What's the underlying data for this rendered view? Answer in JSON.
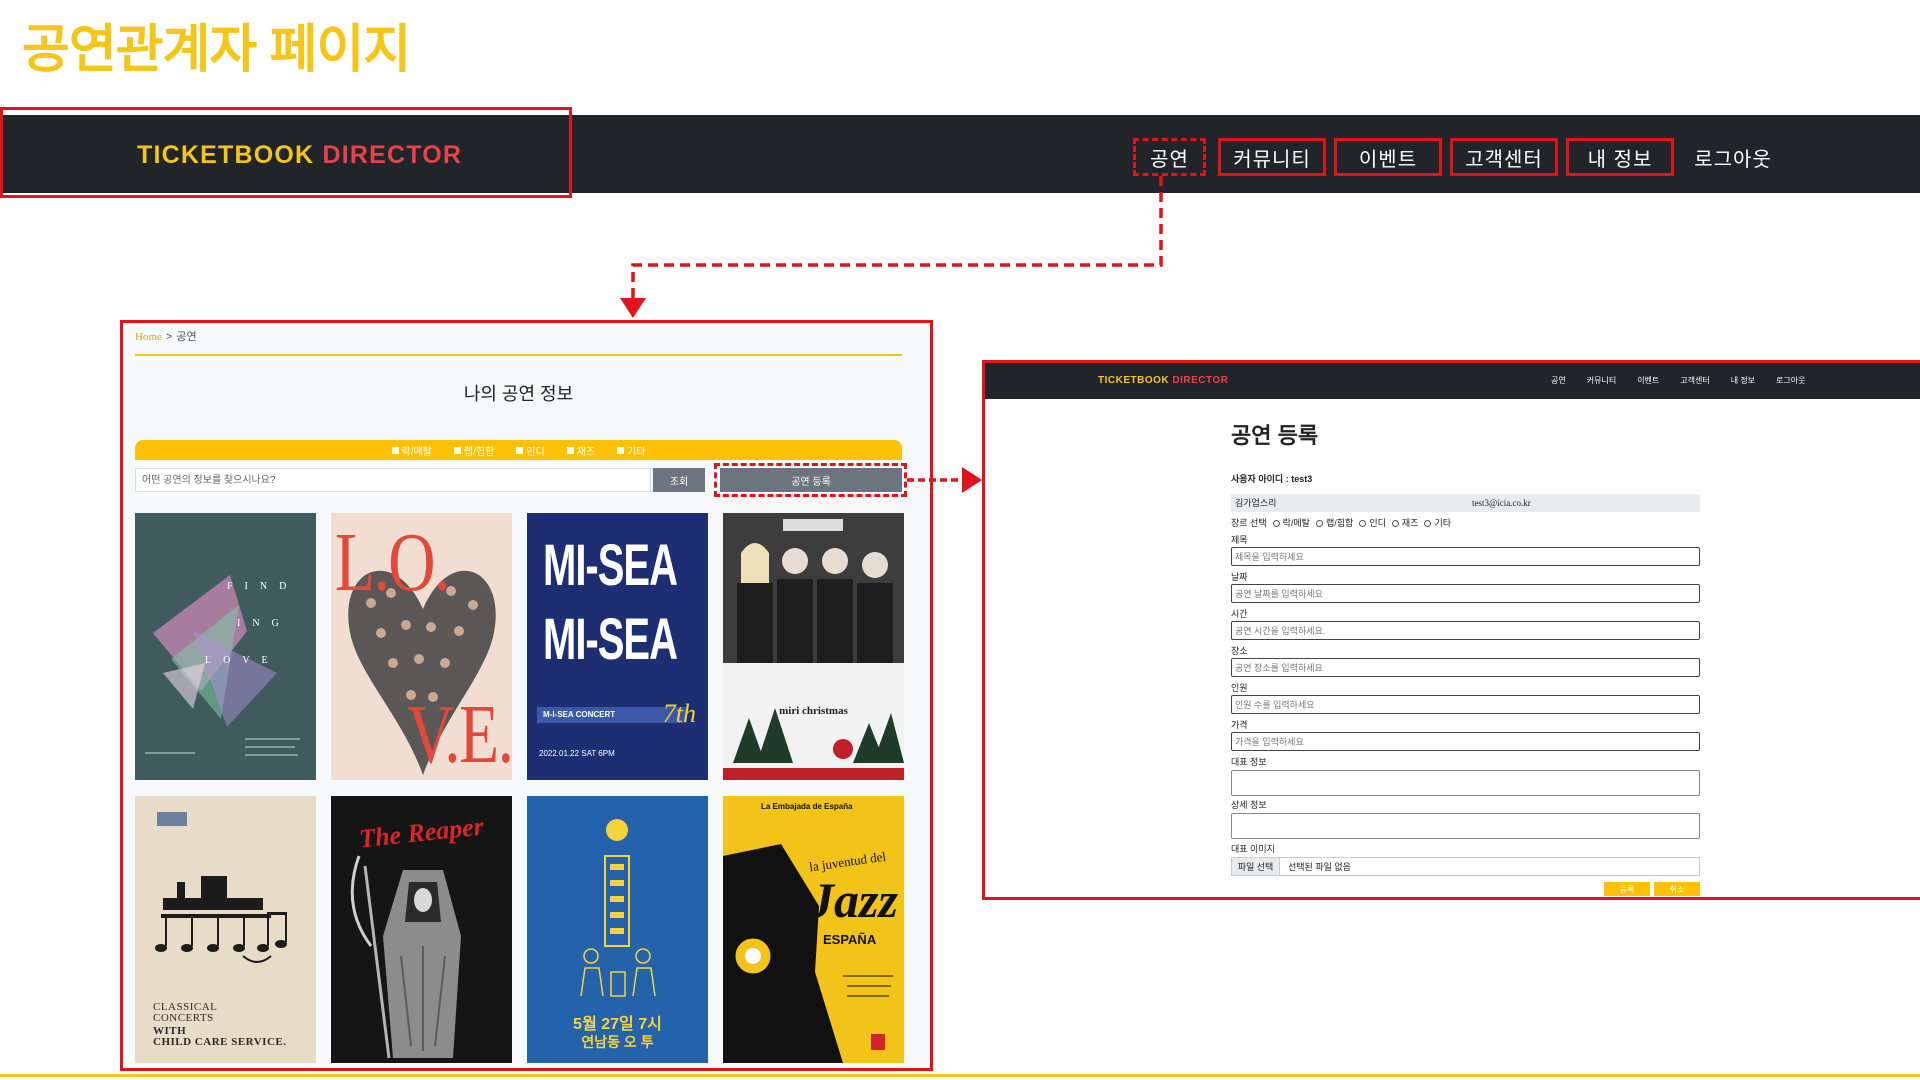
{
  "page_title": "공연관계자 페이지",
  "colors": {
    "accent_yellow": "#f5c518",
    "logo_red": "#e8424a",
    "highlight_red": "#e3131b",
    "nav_bg": "#212529",
    "button_gray": "#6c757d",
    "button_yellow": "#ffc107"
  },
  "header": {
    "logo_ticketbook": "TICKETBOOK",
    "logo_director": "DIRECTOR",
    "nav": [
      {
        "label": "공연"
      },
      {
        "label": "커뮤니티"
      },
      {
        "label": "이벤트"
      },
      {
        "label": "고객센터"
      },
      {
        "label": "내 정보"
      },
      {
        "label": "로그아웃"
      }
    ]
  },
  "performance_list": {
    "breadcrumb": {
      "home": "Home",
      "separator": ">",
      "current": "공연"
    },
    "heading": "나의 공연 정보",
    "genre_filters": [
      {
        "label": "락/메탈",
        "checked": false
      },
      {
        "label": "랩/힙합",
        "checked": false
      },
      {
        "label": "인디",
        "checked": false
      },
      {
        "label": "재즈",
        "checked": false
      },
      {
        "label": "기타",
        "checked": false
      }
    ],
    "search": {
      "placeholder": "어떤 공연의 정보를 찾으시나요?",
      "button": "조회"
    },
    "register_button": "공연 등록",
    "posters": [
      {
        "background": "#3f5b5d",
        "lines": [
          "FIND",
          "ING",
          "LOVE"
        ]
      },
      {
        "background": "#f2ddd2",
        "title_top": "L.O.",
        "title_bottom": "V.E."
      },
      {
        "background": "#1d2f72",
        "logo": "MI-SEA",
        "concert": "M-I-SEA CONCERT",
        "edition": "7th",
        "date": "2022.01.22 SAT 6PM"
      },
      {
        "background": "#4a4a4a",
        "title": "miri christmas"
      },
      {
        "background": "#e7dcc7",
        "lines": [
          "CLASSICAL",
          "CONCERTS",
          "WITH",
          "CHILD CARE SERVICE."
        ]
      },
      {
        "background": "#151515",
        "title": "The Reaper"
      },
      {
        "background": "#2463ab",
        "date": "5월 27일 7시",
        "venue": "연남동 오 투"
      },
      {
        "background": "#f2c318",
        "presenter": "La Embajada de España",
        "title_small": "la juventud del",
        "title": "Jazz",
        "subtitle": "ESPAÑA"
      }
    ]
  },
  "registration_form": {
    "heading": "공연 등록",
    "user_id_label": "사용자 아이디 :",
    "user_id": "test3",
    "company": "김가업스리",
    "email": "test3@icia.co.kr",
    "genre_label": "장르 선택",
    "genres": [
      {
        "label": "락/메탈",
        "selected": false
      },
      {
        "label": "랩/힙합",
        "selected": false
      },
      {
        "label": "인디",
        "selected": false
      },
      {
        "label": "재즈",
        "selected": false
      },
      {
        "label": "기타",
        "selected": false
      }
    ],
    "fields": [
      {
        "label": "제목",
        "placeholder": "제목을 입력하세요"
      },
      {
        "label": "날짜",
        "placeholder": "공연 날짜를 입력하세요"
      },
      {
        "label": "시간",
        "placeholder": "공연 시간을 입력하세요."
      },
      {
        "label": "장소",
        "placeholder": "공연 장소를 입력하세요"
      },
      {
        "label": "인원",
        "placeholder": "인원 수를 입력하세요"
      },
      {
        "label": "가격",
        "placeholder": "가격을 입력하세요"
      }
    ],
    "summary_label": "대표 정보",
    "detail_label": "상세 정보",
    "image_label": "대표 이미지",
    "file_button": "파일 선택",
    "file_status": "선택된 파일 없음",
    "submit_button": "등록",
    "cancel_button": "취소"
  }
}
